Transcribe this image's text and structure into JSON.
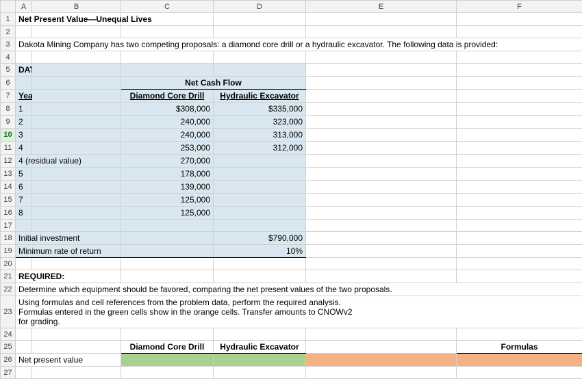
{
  "columns": [
    "A",
    "B",
    "C",
    "D",
    "E",
    "F"
  ],
  "title": "Net Present Value—Unequal Lives",
  "intro": "Dakota Mining Company has two competing proposals: a diamond core drill or a hydraulic excavator. The following data is provided:",
  "data_header": "DATA",
  "ncf_header": "Net Cash Flow",
  "year_label": "Year",
  "col1_label": "Diamond Core Drill",
  "col2_label": "Hydraulic Excavator",
  "rows": [
    {
      "year": "1",
      "d": "$308,000",
      "h": "$335,000"
    },
    {
      "year": "2",
      "d": "240,000",
      "h": "323,000"
    },
    {
      "year": "3",
      "d": "240,000",
      "h": "313,000"
    },
    {
      "year": "4",
      "d": "253,000",
      "h": "312,000"
    },
    {
      "year": "4 (residual value)",
      "d": "270,000",
      "h": ""
    },
    {
      "year": "5",
      "d": "178,000",
      "h": ""
    },
    {
      "year": "6",
      "d": "139,000",
      "h": ""
    },
    {
      "year": "7",
      "d": "125,000",
      "h": ""
    },
    {
      "year": "8",
      "d": "125,000",
      "h": ""
    }
  ],
  "initial_investment_label": "Initial investment",
  "initial_investment_value": "$790,000",
  "min_rate_label": "Minimum rate of return",
  "min_rate_value": "10%",
  "required_label": "REQUIRED:",
  "required_text": "Determine which equipment should be favored, comparing the net present values of the two proposals.",
  "instructions": "Using formulas and cell references from the problem data, perform the required analysis.\nFormulas entered in the green cells show in the orange cells. Transfer amounts to CNOWv2\nfor grading.",
  "result_col1": "Diamond Core Drill",
  "result_col2": "Hydraulic Excavator",
  "formulas_label": "Formulas",
  "npv_label": "Net present value",
  "chart_data": {
    "type": "table",
    "title": "Net Cash Flow",
    "series": [
      {
        "name": "Diamond Core Drill",
        "values": [
          308000,
          240000,
          240000,
          253000,
          270000,
          178000,
          139000,
          125000,
          125000
        ]
      },
      {
        "name": "Hydraulic Excavator",
        "values": [
          335000,
          323000,
          313000,
          312000,
          null,
          null,
          null,
          null,
          null
        ]
      }
    ],
    "categories": [
      "1",
      "2",
      "3",
      "4",
      "4 (residual value)",
      "5",
      "6",
      "7",
      "8"
    ],
    "initial_investment": 790000,
    "minimum_rate_of_return": 0.1
  }
}
